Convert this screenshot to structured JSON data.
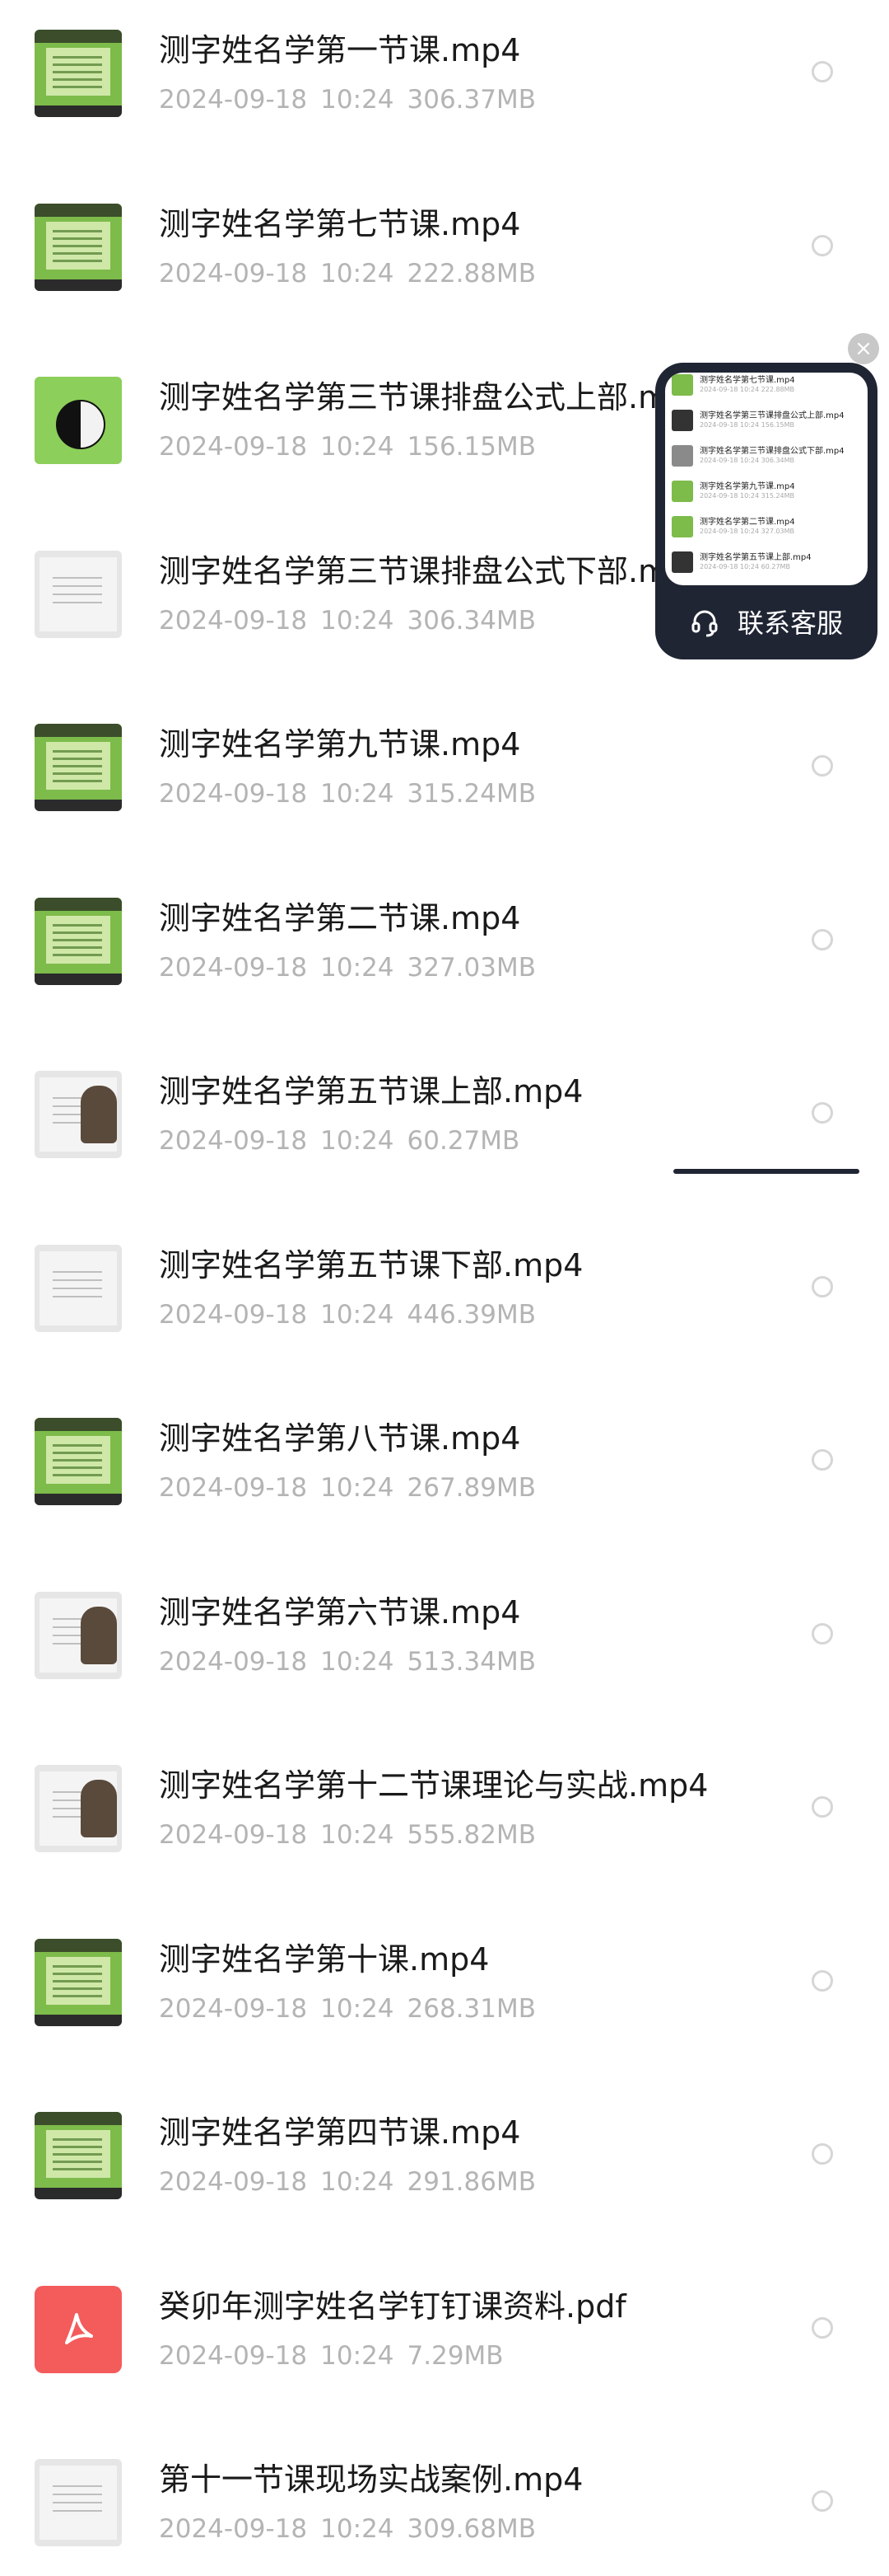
{
  "files": [
    {
      "name": "测字姓名学第一节课.mp4",
      "date": "2024-09-18",
      "time": "10:24",
      "size": "306.37MB",
      "thumb": "green-board"
    },
    {
      "name": "测字姓名学第七节课.mp4",
      "date": "2024-09-18",
      "time": "10:24",
      "size": "222.88MB",
      "thumb": "green-board"
    },
    {
      "name": "测字姓名学第三节课排盘公式上部.mp4",
      "date": "2024-09-18",
      "time": "10:24",
      "size": "156.15MB",
      "thumb": "taiji"
    },
    {
      "name": "测字姓名学第三节课排盘公式下部.mp4",
      "date": "2024-09-18",
      "time": "10:24",
      "size": "306.34MB",
      "thumb": "whiteboard"
    },
    {
      "name": "测字姓名学第九节课.mp4",
      "date": "2024-09-18",
      "time": "10:24",
      "size": "315.24MB",
      "thumb": "green-board"
    },
    {
      "name": "测字姓名学第二节课.mp4",
      "date": "2024-09-18",
      "time": "10:24",
      "size": "327.03MB",
      "thumb": "green-board"
    },
    {
      "name": "测字姓名学第五节课上部.mp4",
      "date": "2024-09-18",
      "time": "10:24",
      "size": "60.27MB",
      "thumb": "person"
    },
    {
      "name": "测字姓名学第五节课下部.mp4",
      "date": "2024-09-18",
      "time": "10:24",
      "size": "446.39MB",
      "thumb": "whiteboard"
    },
    {
      "name": "测字姓名学第八节课.mp4",
      "date": "2024-09-18",
      "time": "10:24",
      "size": "267.89MB",
      "thumb": "green-board"
    },
    {
      "name": "测字姓名学第六节课.mp4",
      "date": "2024-09-18",
      "time": "10:24",
      "size": "513.34MB",
      "thumb": "person"
    },
    {
      "name": "测字姓名学第十二节课理论与实战.mp4",
      "date": "2024-09-18",
      "time": "10:24",
      "size": "555.82MB",
      "thumb": "person"
    },
    {
      "name": "测字姓名学第十课.mp4",
      "date": "2024-09-18",
      "time": "10:24",
      "size": "268.31MB",
      "thumb": "green-board"
    },
    {
      "name": "测字姓名学第四节课.mp4",
      "date": "2024-09-18",
      "time": "10:24",
      "size": "291.86MB",
      "thumb": "green-board"
    },
    {
      "name": "癸卯年测字姓名学钉钉课资料.pdf",
      "date": "2024-09-18",
      "time": "10:24",
      "size": "7.29MB",
      "thumb": "pdf"
    },
    {
      "name": "第十一节课现场实战案例.mp4",
      "date": "2024-09-18",
      "time": "10:24",
      "size": "309.68MB",
      "thumb": "whiteboard"
    }
  ],
  "floating_widget": {
    "close_glyph": "×",
    "service_label": "联系客服",
    "service_icon": "headset-icon",
    "preview_rows": [
      {
        "name": "测字姓名学第七节课.mp4",
        "meta": "2024-09-18 10:24 222.88MB",
        "thumb": "green"
      },
      {
        "name": "测字姓名学第三节课排盘公式上部.mp4",
        "meta": "2024-09-18 10:24 156.15MB",
        "thumb": "dark"
      },
      {
        "name": "测字姓名学第三节课排盘公式下部.mp4",
        "meta": "2024-09-18 10:24 306.34MB",
        "thumb": "gray"
      },
      {
        "name": "测字姓名学第九节课.mp4",
        "meta": "2024-09-18 10:24 315.24MB",
        "thumb": "green"
      },
      {
        "name": "测字姓名学第二节课.mp4",
        "meta": "2024-09-18 10:24 327.03MB",
        "thumb": "green"
      },
      {
        "name": "测字姓名学第五节课上部.mp4",
        "meta": "2024-09-18 10:24 60.27MB",
        "thumb": "dark"
      }
    ]
  },
  "colors": {
    "background": "#ffffff",
    "name_text": "#1a1a1a",
    "meta_text": "#b4b4b4",
    "widget_bg": "#1f2533",
    "pdf_red": "#f45b5b"
  }
}
